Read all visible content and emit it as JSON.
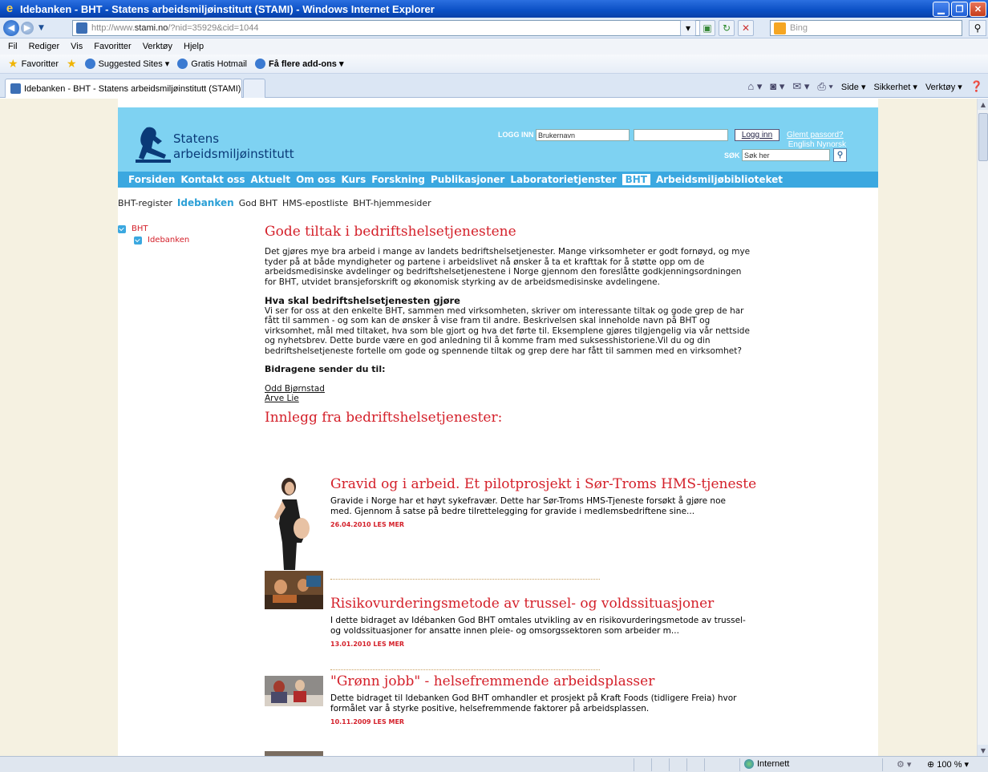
{
  "window": {
    "title": "Idebanken - BHT - Statens arbeidsmiljøinstitutt (STAMI) - Windows Internet Explorer"
  },
  "address": {
    "url_prefix": "http://www.",
    "url_domain": "stami.no",
    "url_rest": "/?nid=35929&cid=1044",
    "search_placeholder": "Bing"
  },
  "menu": [
    "Fil",
    "Rediger",
    "Vis",
    "Favoritter",
    "Verktøy",
    "Hjelp"
  ],
  "favorites": {
    "label": "Favoritter",
    "items": [
      "Suggested Sites ▾",
      "Gratis Hotmail",
      "Få flere add-ons ▾"
    ]
  },
  "tab": {
    "label": "Idebanken - BHT - Statens arbeidsmiljøinstitutt (STAMI)"
  },
  "commandbar": [
    "Side ▾",
    "Sikkerhet ▾",
    "Verktøy ▾"
  ],
  "site": {
    "logo_line1": "Statens",
    "logo_line2": "arbeidsmiljøinstitutt",
    "login_label": "LOGG INN",
    "username_value": "Brukernavn",
    "login_button": "Logg inn",
    "forgot_password": "Glemt passord?",
    "lang_english": "English",
    "lang_nynorsk": "Nynorsk",
    "search_label": "SØK",
    "search_value": "Søk her"
  },
  "mainnav": [
    "Forsiden",
    "Kontakt oss",
    "Aktuelt",
    "Om oss",
    "Kurs",
    "Forskning",
    "Publikasjoner",
    "Laboratorietjenster",
    "BHT",
    "Arbeidsmiljøbiblioteket"
  ],
  "subnav": [
    "BHT-register",
    "Idebanken",
    "God BHT",
    "HMS-epostliste",
    "BHT-hjemmesider"
  ],
  "leftnav": {
    "parent": "BHT",
    "child": "Idebanken"
  },
  "content": {
    "title": "Gode tiltak i bedriftshelsetjenestene",
    "intro": "Det gjøres mye bra arbeid i mange av landets bedriftshelsetjenester. Mange virksomheter er godt fornøyd, og mye tyder på at både myndigheter og partene i arbeidslivet nå ønsker å ta et krafttak for å støtte opp om de arbeidsmedisinske avdelinger og bedriftshelsetjenestene i Norge gjennom den foreslåtte godkjenningsordningen for BHT, utvidet bransjeforskrift og økonomisk styrking av de arbeidsmedisinske avdelingene.",
    "subheading": "Hva skal bedriftshelsetjenesten gjøre",
    "body": "Vi ser for oss at den enkelte BHT, sammen med virksomheten, skriver om interessante tiltak og gode grep de har fått til sammen - og som kan de ønsker å vise fram til andre. Beskrivelsen skal inneholde navn på BHT og virksomhet, mål med tiltaket, hva som ble gjort og hva det førte til. Eksemplene gjøres tilgjengelig via vår nettside og nyhetsbrev. Dette burde være en god anledning til å komme fram med suksesshistoriene.Vil du og din bedriftshelsetjeneste fortelle om gode og spennende tiltak og grep dere har fått til sammen med en virksomhet?",
    "send_to": "Bidragene sender du til:",
    "contact1": "Odd Bjørnstad",
    "contact2": "Arve Lie",
    "section_title": "Innlegg fra bedriftshelsetjenester:"
  },
  "articles": [
    {
      "title": "Gravid og i arbeid. Et pilotprosjekt i Sør-Troms HMS-tjeneste",
      "desc": "Gravide i Norge har et høyt sykefravær. Dette har Sør-Troms HMS-Tjeneste forsøkt å gjøre noe med. Gjennom å satse på bedre tilrettelegging for gravide i medlemsbedriftene sine...",
      "meta": "26.04.2010 LES MER"
    },
    {
      "title": "Risikovurderingsmetode av trussel- og voldssituasjoner",
      "desc": "I dette bidraget av Idébanken God BHT omtales utvikling av en risikovurderingsmetode av trussel- og voldssituasjoner for ansatte innen pleie- og omsorgssektoren som arbeider m...",
      "meta": "13.01.2010 LES MER"
    },
    {
      "title": "\"Grønn jobb\" - helsefremmende arbeidsplasser",
      "desc": "Dette bidraget til Idebanken God BHT omhandler et prosjekt på Kraft Foods (tidligere Freia) hvor formålet var å styrke positive, helsefremmende faktorer på arbeidsplassen.",
      "meta": "10.11.2009 LES MER"
    }
  ],
  "status": {
    "zone": "Internett",
    "zoom": "100 %"
  }
}
